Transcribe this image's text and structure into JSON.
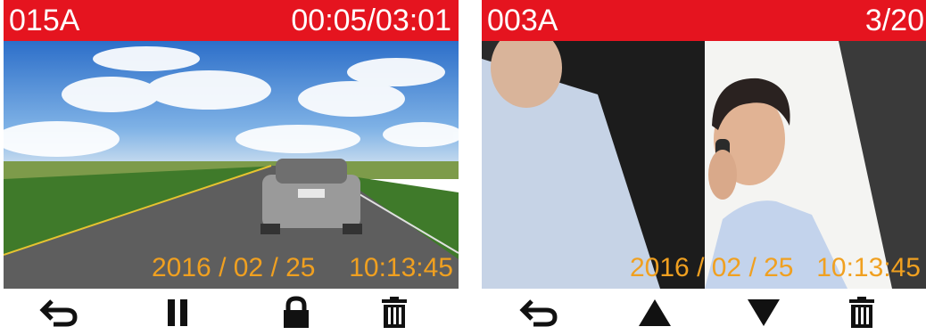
{
  "left_screen": {
    "file_name": "015A",
    "time_progress": "00:05/03:01",
    "date": "2016 / 02 / 25",
    "time": "10:13:45",
    "controls": [
      "back-icon",
      "pause-icon",
      "lock-icon",
      "trash-icon"
    ]
  },
  "right_screen": {
    "file_name": "003A",
    "page_counter": "3/20",
    "date": "2016 / 02 / 25",
    "time": "10:13:45",
    "controls": [
      "back-icon",
      "up-triangle-icon",
      "down-triangle-icon",
      "trash-icon"
    ]
  },
  "colors": {
    "header": "#e5141f",
    "overlay_text": "#f0a020",
    "icon": "#111111"
  }
}
